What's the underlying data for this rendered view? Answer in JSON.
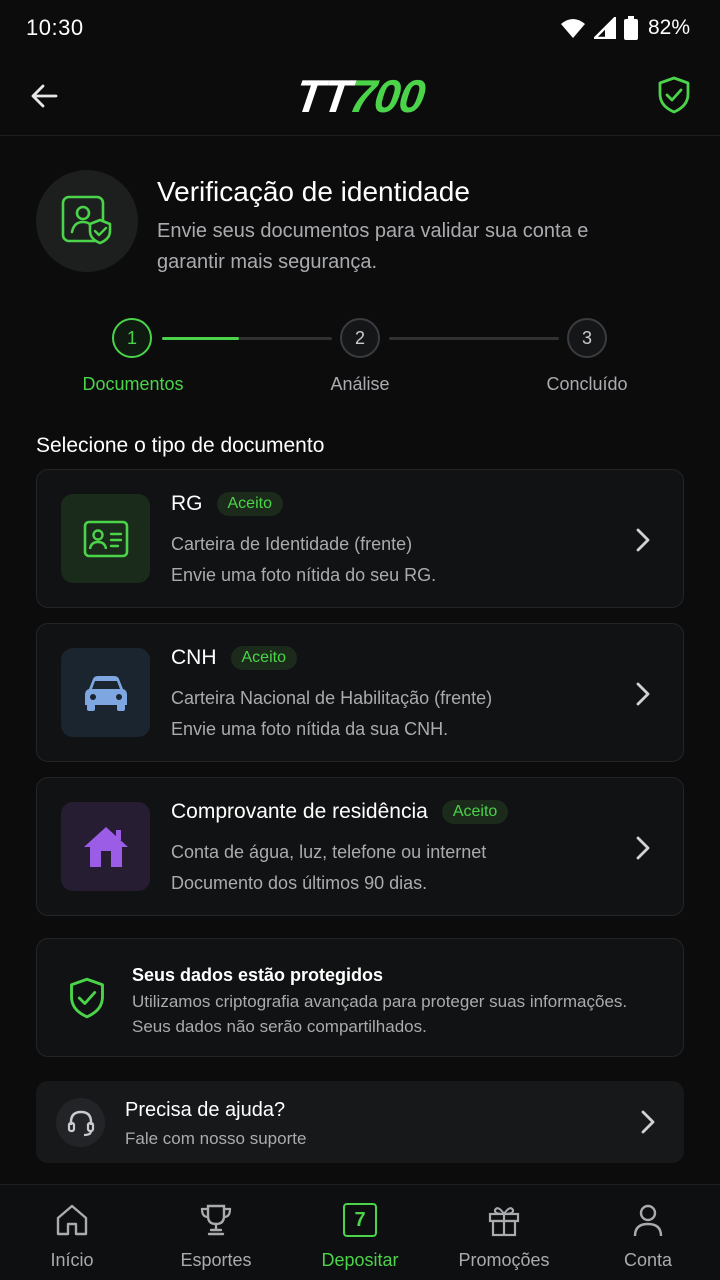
{
  "status_bar": {
    "time": "10:30",
    "battery": "82%"
  },
  "header": {
    "logo_part1": "TT",
    "logo_part2": "700"
  },
  "hero": {
    "title": "Verificação de identidade",
    "description": "Envie seus documentos para validar sua conta e garantir mais segurança."
  },
  "stepper": {
    "progress_fraction": 0.45,
    "steps": [
      {
        "number": "1",
        "label": "Documentos",
        "state": "active"
      },
      {
        "number": "2",
        "label": "Análise",
        "state": "pending"
      },
      {
        "number": "3",
        "label": "Concluído",
        "state": "pending"
      }
    ]
  },
  "section_title": "Selecione o tipo de documento",
  "documents": [
    {
      "title": "RG",
      "badge": "Aceito",
      "line1": "Carteira de Identidade (frente)",
      "line2": "Envie uma foto nítida do seu RG.",
      "icon": "id-card-icon",
      "color": "#4bd34a"
    },
    {
      "title": "CNH",
      "badge": "Aceito",
      "line1": "Carteira Nacional de Habilitação (frente)",
      "line2": "Envie uma foto nítida da sua CNH.",
      "icon": "car-icon",
      "color": "#7ea6e0"
    },
    {
      "title": "Comprovante de residência",
      "badge": "Aceito",
      "line1": "Conta de água, luz, telefone ou internet",
      "line2": "Documento dos últimos 90 dias.",
      "icon": "house-icon",
      "color": "#9b5de5"
    }
  ],
  "security": {
    "title": "Seus dados estão protegidos",
    "description": "Utilizamos criptografia avançada para proteger suas informações. Seus dados não serão compartilhados."
  },
  "help": {
    "title": "Precisa de ajuda?",
    "subtitle": "Fale com nosso suporte"
  },
  "nav": {
    "items": [
      {
        "label": "Início",
        "icon": "home-icon"
      },
      {
        "label": "Esportes",
        "icon": "trophy-icon"
      },
      {
        "label": "Depositar",
        "icon": "deposit-icon",
        "badge": "7",
        "active": true
      },
      {
        "label": "Promoções",
        "icon": "gift-icon"
      },
      {
        "label": "Conta",
        "icon": "user-icon"
      }
    ]
  },
  "colors": {
    "accent": "#4bd34a",
    "background": "#0c0c0d",
    "card": "#111213"
  }
}
